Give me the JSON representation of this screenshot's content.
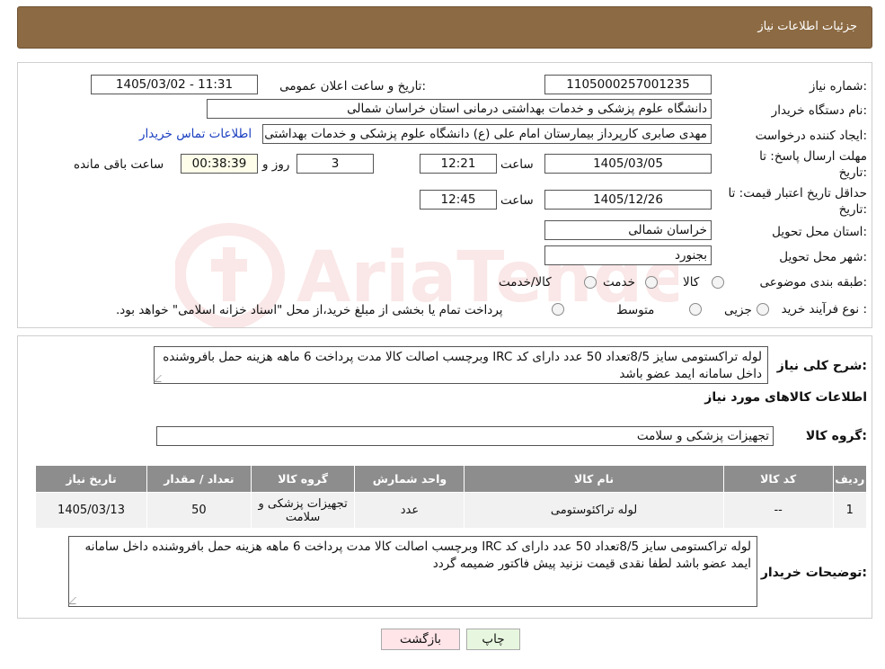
{
  "header": {
    "title": "جزئیات اطلاعات نیاز"
  },
  "need_number": {
    "label": "شماره نیاز:",
    "value": "1105000257001235"
  },
  "announce": {
    "label": "تاریخ و ساعت اعلان عمومی:",
    "value": "1405/03/02 - 11:31"
  },
  "buyer_org": {
    "label": "نام دستگاه خریدار:",
    "value": "دانشگاه علوم پزشکی و خدمات بهداشتی درمانی استان خراسان شمالی"
  },
  "creator": {
    "label": "ایجاد کننده درخواست:",
    "value": "مهدی صابری کارپرداز بیمارستان امام علی (ع) دانشگاه علوم پزشکی و خدمات بهداشتی",
    "contact_link": "اطلاعات تماس خریدار"
  },
  "deadline": {
    "label_line1": "مهلت ارسال پاسخ: تا",
    "label_line2": "تاریخ:",
    "date": "1405/03/05",
    "time_label": "ساعت",
    "time": "12:21",
    "days": "3",
    "days_label": "روز و",
    "remaining": "00:38:39",
    "remaining_label": "ساعت باقی مانده"
  },
  "validity": {
    "label_line1": "حداقل تاریخ اعتبار قیمت: تا",
    "label_line2": "تاریخ:",
    "date": "1405/12/26",
    "time_label": "ساعت",
    "time": "12:45"
  },
  "province": {
    "label": "استان محل تحویل:",
    "value": "خراسان شمالی"
  },
  "city": {
    "label": "شهر محل تحویل:",
    "value": "بجنورد"
  },
  "category": {
    "label": "طبقه بندی موضوعی:",
    "options": [
      "کالا",
      "خدمت",
      "کالا/خدمت"
    ]
  },
  "process": {
    "label": "نوع فرآیند خرید :",
    "options": [
      "جزیی",
      "متوسط"
    ],
    "note": "پرداخت تمام یا بخشی از مبلغ خرید،از محل \"اسناد خزانه اسلامی\" خواهد بود."
  },
  "summary": {
    "label": "شرح کلی نیاز:",
    "text": "لوله تراکستومی سایز 8/5تعداد 50 عدد دارای کد IRC وبرچسب اصالت  کالا مدت پرداخت 6 ماهه هزینه حمل بافروشنده داخل سامانه ایمد عضو باشد"
  },
  "goods_info": {
    "title": "اطلاعات کالاهای مورد نیاز"
  },
  "goods_group": {
    "label": "گروه کالا:",
    "value": "تجهیزات پزشکی و سلامت"
  },
  "table": {
    "headers": [
      "ردیف",
      "کد کالا",
      "نام کالا",
      "واحد شمارش",
      "گروه کالا",
      "تعداد / مقدار",
      "تاریخ نیاز"
    ],
    "rows": [
      [
        "1",
        "--",
        "لوله تراکئوستومی",
        "عدد",
        "تجهیزات پزشکی و سلامت",
        "50",
        "1405/03/13"
      ]
    ]
  },
  "buyer_notes": {
    "label": "توضیحات خریدار:",
    "text": "لوله تراکستومی سایز 8/5تعداد 50 عدد دارای کد IRC وبرچسب اصالت  کالا مدت پرداخت 6 ماهه هزینه حمل بافروشنده داخل سامانه ایمد عضو باشد لطفا نقدی قیمت نزنید  پیش فاکتور ضمیمه گردد"
  },
  "buttons": {
    "print": "چاپ",
    "back": "بازگشت"
  },
  "watermark": {
    "text": "AriaTender.neT"
  },
  "colors": {
    "header_bg": "#8c6a43",
    "table_header_bg": "#8d8d8d",
    "link": "#1a3fc0"
  }
}
